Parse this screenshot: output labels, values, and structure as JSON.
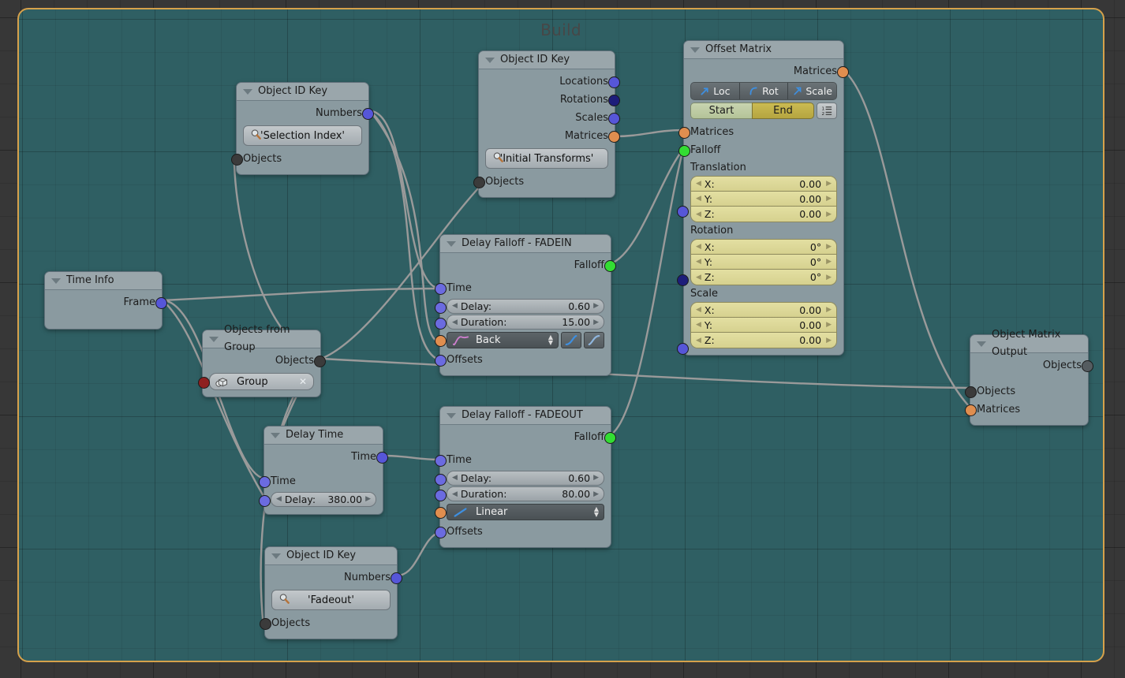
{
  "frame": {
    "label": "Build"
  },
  "nodes": {
    "object_id_key_1": {
      "title": "Object ID Key",
      "outputs": [
        {
          "label": "Numbers",
          "socket": "blue"
        }
      ],
      "id_field": {
        "icon": "magnifier-icon",
        "value": "'Selection Index'"
      },
      "inputs": [
        {
          "label": "Objects",
          "socket": "black"
        }
      ]
    },
    "object_id_key_2": {
      "title": "Object ID Key",
      "outputs": [
        {
          "label": "Locations",
          "socket": "blue"
        },
        {
          "label": "Rotations",
          "socket": "navy"
        },
        {
          "label": "Scales",
          "socket": "blue"
        },
        {
          "label": "Matrices",
          "socket": "orange"
        }
      ],
      "id_field": {
        "icon": "magnifier-icon",
        "value": "'Initial Transforms'"
      },
      "inputs": [
        {
          "label": "Objects",
          "socket": "black"
        }
      ]
    },
    "object_id_key_3": {
      "title": "Object ID Key",
      "outputs": [
        {
          "label": "Numbers",
          "socket": "blue"
        }
      ],
      "id_field": {
        "icon": "magnifier-icon",
        "value": "'Fadeout'"
      },
      "inputs": [
        {
          "label": "Objects",
          "socket": "black"
        }
      ]
    },
    "time_info": {
      "title": "Time Info",
      "outputs": [
        {
          "label": "Frame",
          "socket": "blue"
        }
      ]
    },
    "objects_from_group": {
      "title": "Objects from Group",
      "outputs": [
        {
          "label": "Objects",
          "socket": "black"
        }
      ],
      "group_field": {
        "icon": "group-icon",
        "value": "Group",
        "clear": "✕"
      },
      "inputs": [
        {
          "label": "",
          "socket": "red"
        }
      ]
    },
    "delay_time": {
      "title": "Delay Time",
      "outputs": [
        {
          "label": "Time",
          "socket": "blue"
        }
      ],
      "inputs": [
        {
          "label": "Time",
          "socket": "blue"
        }
      ],
      "delay": {
        "name": "Delay:",
        "value": "380.00"
      }
    },
    "delay_falloff_fadein": {
      "title": "Delay Falloff - FADEIN",
      "outputs": [
        {
          "label": "Falloff",
          "socket": "green"
        }
      ],
      "time_label": "Time",
      "delay": {
        "name": "Delay:",
        "value": "0.60"
      },
      "duration": {
        "name": "Duration:",
        "value": "15.00"
      },
      "interpolation": "Back",
      "offsets_label": "Offsets"
    },
    "delay_falloff_fadeout": {
      "title": "Delay Falloff - FADEOUT",
      "outputs": [
        {
          "label": "Falloff",
          "socket": "green"
        }
      ],
      "time_label": "Time",
      "delay": {
        "name": "Delay:",
        "value": "0.60"
      },
      "duration": {
        "name": "Duration:",
        "value": "80.00"
      },
      "interpolation": "Linear",
      "offsets_label": "Offsets"
    },
    "offset_matrix": {
      "title": "Offset Matrix",
      "output_label": "Matrices",
      "toggles": [
        {
          "label": "Loc",
          "icon": "arrow-icon"
        },
        {
          "label": "Rot",
          "icon": "rotate-icon"
        },
        {
          "label": "Scale",
          "icon": "scale-icon"
        }
      ],
      "start_label": "Start",
      "end_label": "End",
      "list_icon": "list-icon",
      "inputs": [
        {
          "label": "Matrices",
          "socket": "orange"
        },
        {
          "label": "Falloff",
          "socket": "green"
        }
      ],
      "translation": {
        "header": "Translation",
        "fields": [
          {
            "name": "X:",
            "value": "0.00"
          },
          {
            "name": "Y:",
            "value": "0.00"
          },
          {
            "name": "Z:",
            "value": "0.00"
          }
        ]
      },
      "rotation": {
        "header": "Rotation",
        "fields": [
          {
            "name": "X:",
            "value": "0°"
          },
          {
            "name": "Y:",
            "value": "0°"
          },
          {
            "name": "Z:",
            "value": "0°"
          }
        ]
      },
      "scale": {
        "header": "Scale",
        "fields": [
          {
            "name": "X:",
            "value": "0.00"
          },
          {
            "name": "Y:",
            "value": "0.00"
          },
          {
            "name": "Z:",
            "value": "0.00"
          }
        ]
      }
    },
    "object_matrix_output": {
      "title": "Object Matrix Output",
      "outputs": [
        {
          "label": "Objects",
          "socket": "black"
        }
      ],
      "inputs": [
        {
          "label": "Objects",
          "socket": "black"
        },
        {
          "label": "Matrices",
          "socket": "orange"
        }
      ]
    }
  },
  "colors": {
    "frame_border": "#d6a14b",
    "frame_bg": "#2f5f63",
    "node_bg": "#8a9aa0",
    "socket_blue": "#5656d8",
    "socket_navy": "#1d1d7a",
    "socket_green": "#33dd33",
    "socket_orange": "#e08e4f",
    "socket_red": "#8e2020",
    "link": "#9a9a9a"
  }
}
